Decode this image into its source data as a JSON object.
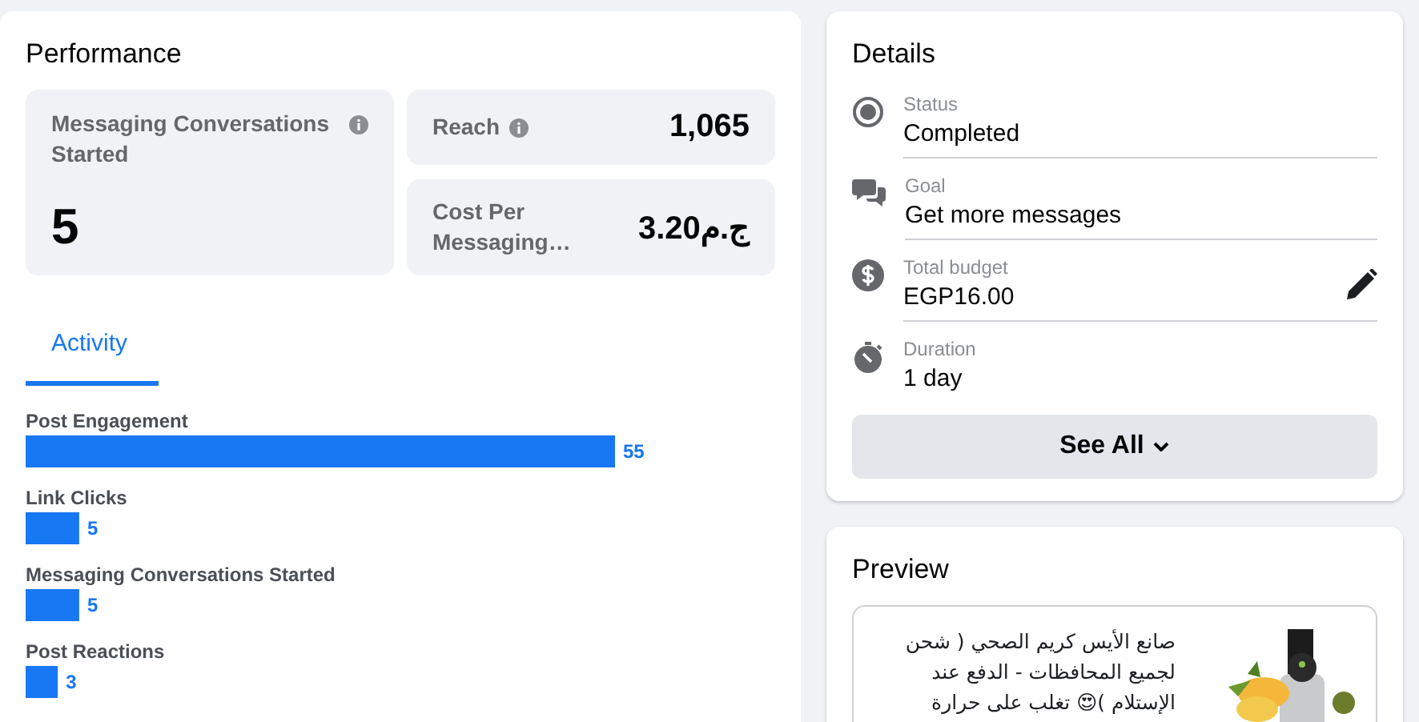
{
  "performance": {
    "title": "Performance",
    "metrics": [
      {
        "label": "Messaging Conversations Started",
        "info": true,
        "value": "5",
        "kind": "large"
      },
      {
        "label": "Reach",
        "info": true,
        "value": "1,065",
        "kind": "small"
      },
      {
        "label": "Cost Per Messaging…",
        "info": false,
        "value": "3.20ج.م",
        "kind": "small"
      }
    ],
    "tabs": [
      {
        "label": "Activity",
        "selected": true
      }
    ],
    "chart_data": {
      "type": "bar",
      "orientation": "horizontal",
      "categories": [
        "Post Engagement",
        "Link Clicks",
        "Messaging Conversations Started",
        "Post Reactions"
      ],
      "values": [
        55,
        5,
        5,
        3
      ],
      "data_labels": true
    }
  },
  "details": {
    "title": "Details",
    "rows": [
      {
        "kind": "status",
        "label": "Status",
        "value": "Completed",
        "editable": false
      },
      {
        "kind": "goal",
        "label": "Goal",
        "value": "Get more messages",
        "editable": false
      },
      {
        "kind": "budget",
        "label": "Total budget",
        "value": "EGP16.00",
        "editable": true
      },
      {
        "kind": "duration",
        "label": "Duration",
        "value": "1 day",
        "editable": false
      }
    ],
    "button": "See All"
  },
  "preview": {
    "title": "Preview",
    "text": "صانع الأيس كريم الصحي ( شحن لجميع المحافظات - الدفع عند الإستلام )😍 تغلب على حرارة"
  }
}
